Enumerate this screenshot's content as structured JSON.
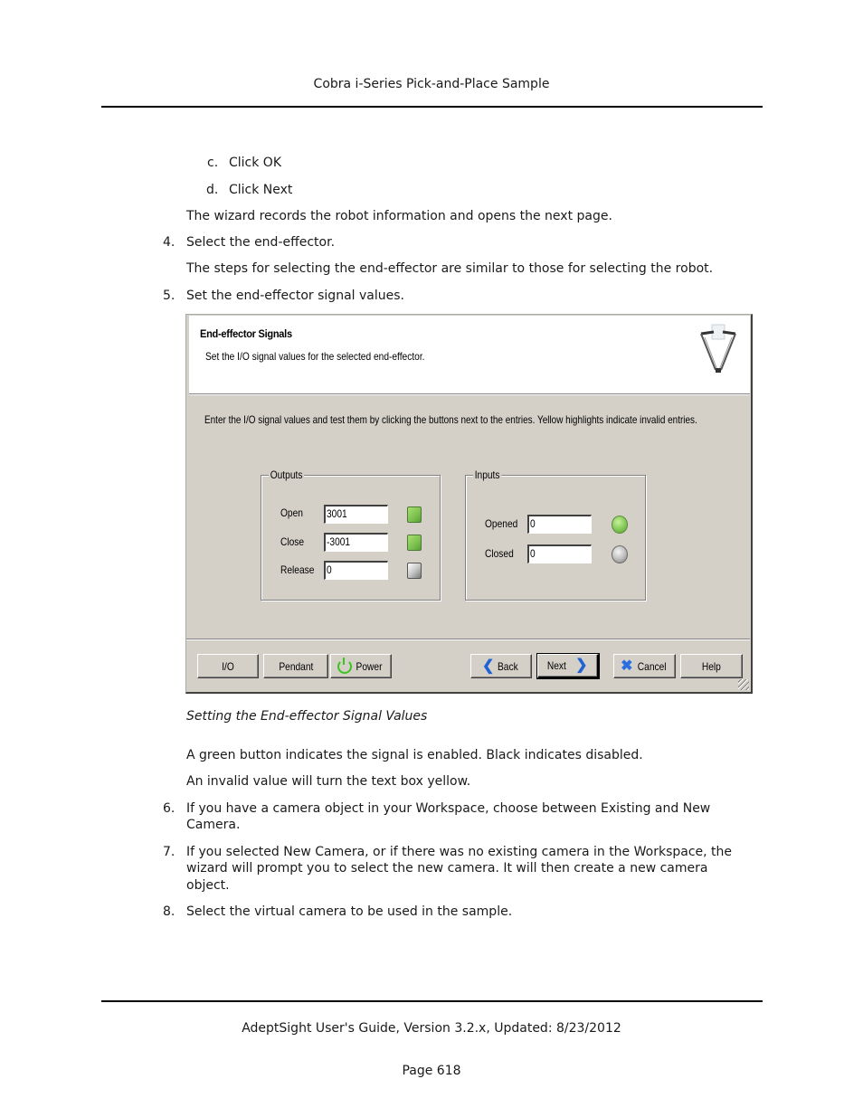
{
  "page_header": "Cobra i-Series Pick-and-Place Sample",
  "steps_before": {
    "sub_c": {
      "marker": "c.",
      "text": "Click OK"
    },
    "sub_d": {
      "marker": "d.",
      "text": "Click Next"
    },
    "note_1": "The wizard records the robot information and opens the next page.",
    "step_4": {
      "marker": "4.",
      "text": "Select the end-effector."
    },
    "note_2": "The steps for selecting the end-effector are similar to those for selecting the robot.",
    "step_5": {
      "marker": "5.",
      "text": "Set the end-effector signal values."
    }
  },
  "dialog": {
    "title": "End-effector Signals",
    "subtitle": "Set the I/O signal values for the selected end-effector.",
    "header_icon": "robot-icon",
    "instructions": "Enter the I/O signal values and test them by clicking the buttons next to the entries.  Yellow highlights indicate invalid entries.",
    "outputs": {
      "legend": "Outputs",
      "rows": [
        {
          "label": "Open",
          "value": "3001",
          "indicator": "green",
          "indicator_color": "#7cc050"
        },
        {
          "label": "Close",
          "value": "-3001",
          "indicator": "green",
          "indicator_color": "#7cc050"
        },
        {
          "label": "Release",
          "value": "0",
          "indicator": "gray",
          "indicator_color": "#c0c0c0"
        }
      ]
    },
    "inputs": {
      "legend": "Inputs",
      "rows": [
        {
          "label": "Opened",
          "value": "0",
          "indicator": "green",
          "indicator_color": "#8ed060"
        },
        {
          "label": "Closed",
          "value": "0",
          "indicator": "gray",
          "indicator_color": "#c0c0c0"
        }
      ]
    },
    "buttons": {
      "io": "I/O",
      "pendant": "Pendant",
      "power": "Power",
      "back": "Back",
      "next": "Next",
      "cancel": "Cancel",
      "help": "Help"
    },
    "icons": {
      "power": "power-icon",
      "back": "back-arrow-icon",
      "next": "next-arrow-icon",
      "cancel": "cancel-x-icon"
    }
  },
  "caption": "Setting the End-effector Signal Values",
  "steps_after": {
    "note_3": "A green button indicates the signal is enabled. Black indicates disabled.",
    "note_4": "An invalid value will turn the text box yellow.",
    "step_6": {
      "marker": "6.",
      "line1": "If you have a camera object in your Workspace, choose between Existing and New",
      "line2": "Camera."
    },
    "step_7": {
      "marker": "7.",
      "line1": "If you selected New Camera, or if there was no existing camera in the Workspace, the",
      "line2": "wizard will prompt you to select the new camera. It will then create a new camera",
      "line3": "object."
    },
    "step_8": {
      "marker": "8.",
      "text": "Select the virtual camera to be used in the sample."
    }
  },
  "page_footer": {
    "guide": "AdeptSight User's Guide,  Version 3.2.x, Updated: 8/23/2012",
    "page": "Page 618"
  }
}
